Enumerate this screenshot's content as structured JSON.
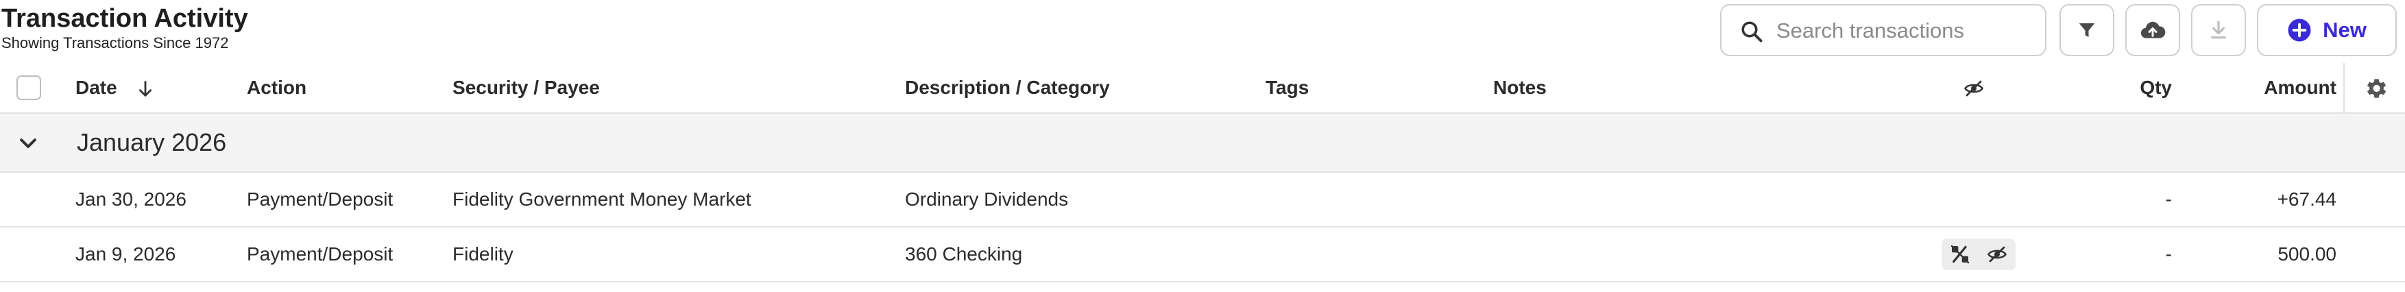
{
  "page": {
    "title": "Transaction Activity",
    "subtitle": "Showing Transactions Since 1972"
  },
  "toolbar": {
    "search_placeholder": "Search transactions",
    "new_label": "New",
    "accent": "#3b2bd6"
  },
  "table": {
    "columns": {
      "date": "Date",
      "action": "Action",
      "security": "Security / Payee",
      "description": "Description / Category",
      "tags": "Tags",
      "notes": "Notes",
      "qty": "Qty",
      "amount": "Amount"
    },
    "sort": {
      "column": "date",
      "direction": "descending"
    },
    "groups": [
      {
        "label": "January 2026",
        "rows": [
          {
            "date": "Jan 30, 2026",
            "action": "Payment/Deposit",
            "security": "Fidelity Government Money Market",
            "description": "Ordinary Dividends",
            "tags": "",
            "notes": "",
            "qty": "-",
            "amount": "+67.44",
            "has_icons": false
          },
          {
            "date": "Jan 9, 2026",
            "action": "Payment/Deposit",
            "security": "Fidelity",
            "description": "360 Checking",
            "tags": "",
            "notes": "",
            "qty": "-",
            "amount": "500.00",
            "has_icons": true,
            "icons": [
              "percent-off-icon",
              "eye-off-icon"
            ]
          }
        ]
      }
    ]
  },
  "colors": {
    "positive_amount": "#2f8a3a",
    "group_bg": "#f4f4f5"
  }
}
